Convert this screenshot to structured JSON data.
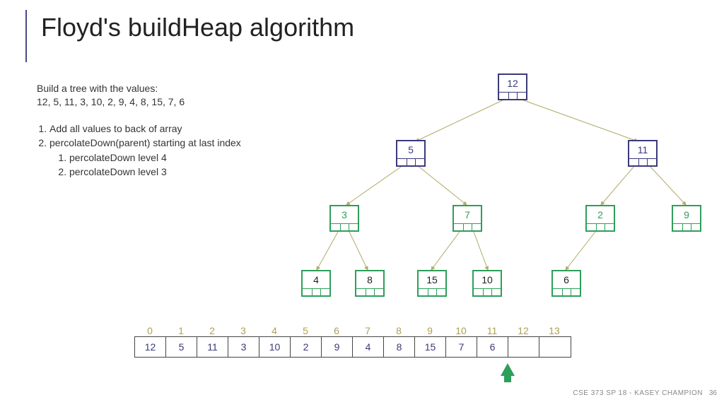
{
  "title": "Floyd's buildHeap algorithm",
  "intro_line1": "Build a tree with the values:",
  "intro_line2": "12, 5, 11, 3, 10, 2, 9, 4, 8, 15, 7, 6",
  "steps": {
    "s1": "Add all values to back of array",
    "s2": "percolateDown(parent) starting at last index",
    "s2a": "percolateDown level 4",
    "s2b": "percolateDown level 3"
  },
  "tree": {
    "n0": "12",
    "n1": "5",
    "n2": "11",
    "n3": "3",
    "n4": "7",
    "n5": "2",
    "n6": "9",
    "n7": "4",
    "n8": "8",
    "n9": "15",
    "n10": "10",
    "n11": "6"
  },
  "array": {
    "indices": [
      "0",
      "1",
      "2",
      "3",
      "4",
      "5",
      "6",
      "7",
      "8",
      "9",
      "10",
      "11",
      "12",
      "13"
    ],
    "values": [
      "12",
      "5",
      "11",
      "3",
      "10",
      "2",
      "9",
      "4",
      "8",
      "15",
      "7",
      "6",
      "",
      ""
    ]
  },
  "footer": "CSE 373 SP 18 - KASEY CHAMPION",
  "slide": "36"
}
